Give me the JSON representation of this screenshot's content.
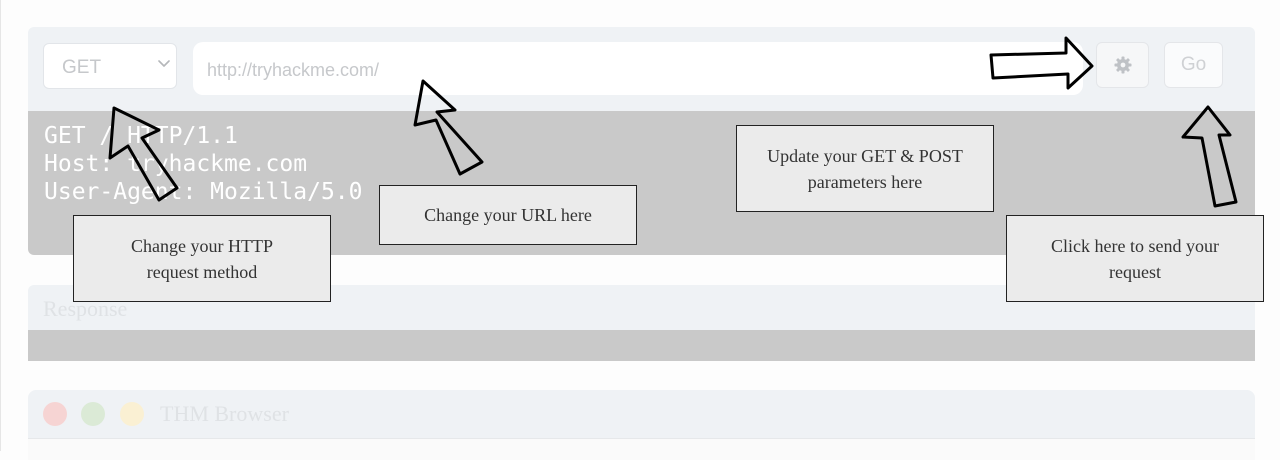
{
  "request": {
    "method": "GET",
    "url_placeholder": "http://tryhackme.com/",
    "go_label": "Go",
    "lines": [
      "GET / HTTP/1.1",
      "Host: tryhackme.com",
      "User-Agent: Mozilla/5.0"
    ]
  },
  "response": {
    "title": "Response"
  },
  "browser": {
    "title": "THM Browser"
  },
  "callouts": {
    "method": "Change your HTTP request method",
    "url": "Change your URL here",
    "params": "Update your GET & POST parameters here",
    "send": "Click here to send your request"
  },
  "icons": {
    "method_dropdown": "chevron-down-icon",
    "settings": "gear-icon"
  },
  "colors": {
    "panel_header": "#eff2f5",
    "panel_body": "#c9c9c9",
    "dot_red": "#f6d4d3",
    "dot_green": "#dbead6",
    "dot_yellow": "#faf0d3"
  }
}
